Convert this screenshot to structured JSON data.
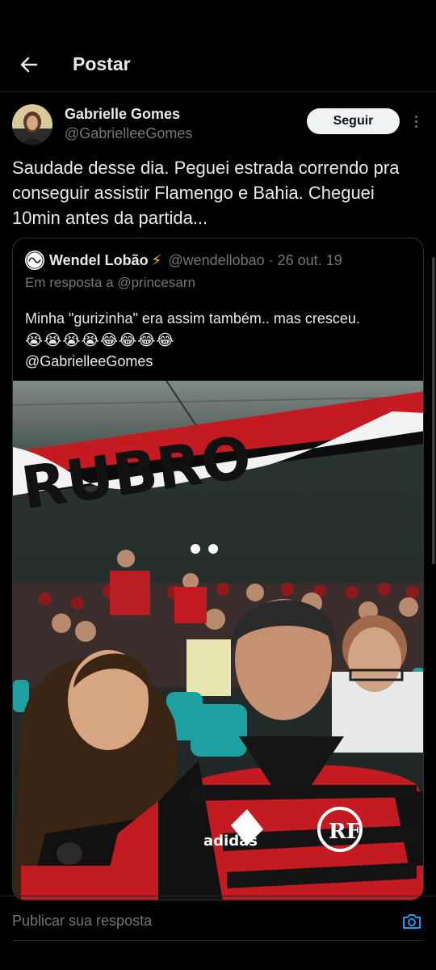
{
  "header": {
    "title": "Postar"
  },
  "post": {
    "author_name": "Gabrielle Gomes",
    "author_handle": "@GabrielleeGomes",
    "follow_label": "Seguir",
    "text": "Saudade desse dia. Peguei estrada correndo pra conseguir assistir Flamengo e Bahia. Cheguei 10min antes da partida..."
  },
  "quote": {
    "name": "Wendel Lobão",
    "meta": "@wendellobao · 26 out. 19",
    "reply_to": "Em resposta a @princesarn",
    "text": "Minha \"gurizinha\" era assim também.. mas cresceu.",
    "emojis": [
      "😭",
      "😭",
      "😭",
      "😭",
      "😂",
      "😂",
      "😂",
      "😂"
    ],
    "mention": "@GabrielleeGomes",
    "banner_text": "RUBRO",
    "shirt_brand": "adidas"
  },
  "reply": {
    "placeholder": "Publicar sua resposta"
  },
  "colors": {
    "background": "#000000",
    "text": "#e7e9ea",
    "muted": "#71767b",
    "border": "#2f3336",
    "link_blue": "#1d9bf0",
    "flamengo_red": "#d11a20"
  },
  "icons": {
    "back": "arrow-left-icon",
    "more": "more-vertical-icon",
    "camera": "camera-icon",
    "bolt": "lightning-bolt-icon"
  }
}
